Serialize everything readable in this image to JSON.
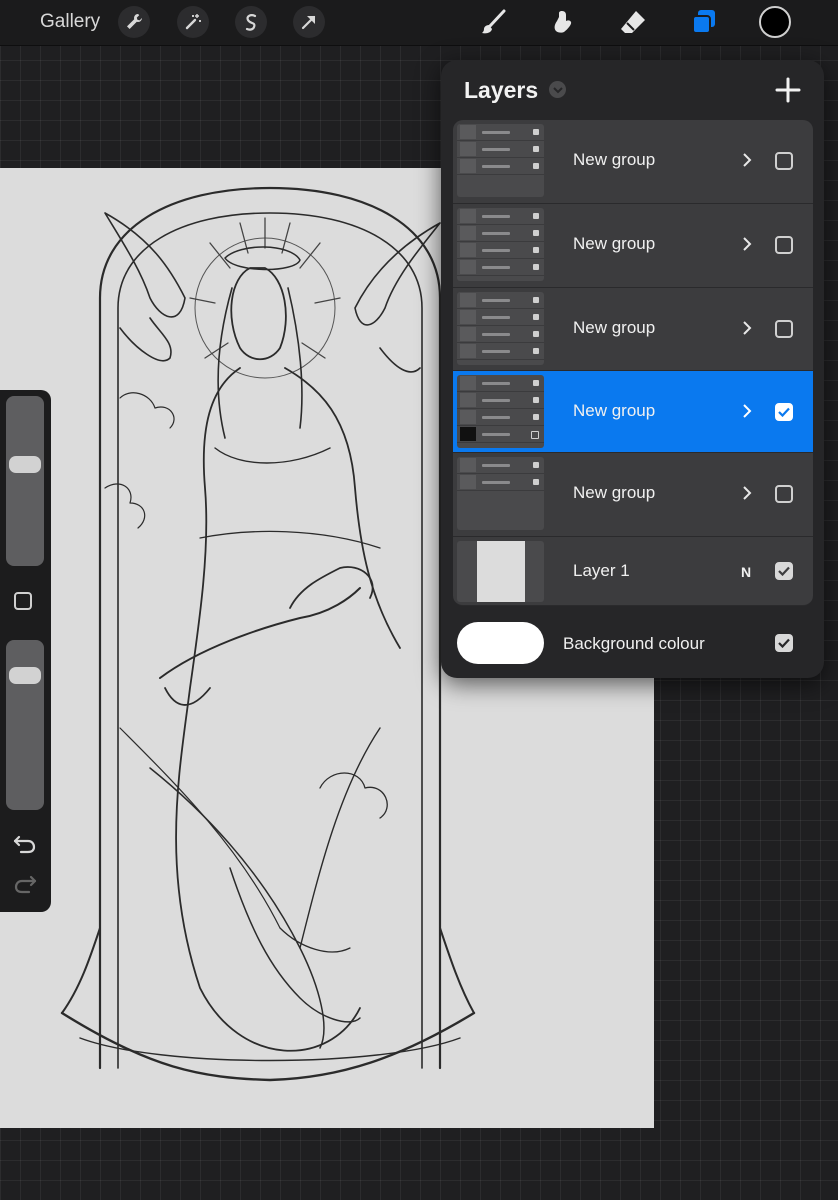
{
  "topbar": {
    "gallery_label": "Gallery",
    "left_tools": [
      "wrench-icon",
      "magic-wand-icon",
      "selection-icon",
      "transform-arrow-icon"
    ],
    "right_tools": [
      "brush-icon",
      "smudge-icon",
      "eraser-icon",
      "layers-icon",
      "color-swatch"
    ],
    "active_tool": "layers-icon",
    "active_color": "#000000",
    "accent_color": "#0a79ef"
  },
  "sidebar": {
    "brush_size_level": 0.13,
    "opacity_level": 0.2,
    "items": [
      "brush-size-slider",
      "modify-button",
      "opacity-slider",
      "undo-icon",
      "redo-icon"
    ]
  },
  "layers_panel": {
    "title": "Layers",
    "add_icon": "plus-icon",
    "layers": [
      {
        "name": "New group",
        "type": "group",
        "visible": false,
        "selected": false,
        "thumb_rows": [
          "Layer 3",
          "New group",
          "Layer 15"
        ]
      },
      {
        "name": "New group",
        "type": "group",
        "visible": false,
        "selected": false,
        "thumb_rows": [
          "Layer 3",
          "Layer 4",
          "Layer 13",
          "Layer 20"
        ]
      },
      {
        "name": "New group",
        "type": "group",
        "visible": false,
        "selected": false,
        "thumb_rows": [
          "Layer 3",
          "Layer 6",
          "Layer 12",
          "Layer 4"
        ]
      },
      {
        "name": "New group",
        "type": "group",
        "visible": true,
        "selected": true,
        "thumb_rows": [
          "Layer 28",
          "Layer 24",
          "Layer 19",
          "Inserted Image"
        ]
      },
      {
        "name": "New group",
        "type": "group",
        "visible": false,
        "selected": false,
        "thumb_rows": [
          "Layer 3",
          "From selection"
        ]
      },
      {
        "name": "Layer 1",
        "type": "layer",
        "blend_mode": "N",
        "visible": true,
        "selected": false
      }
    ],
    "background": {
      "label": "Background colour",
      "color": "#ffffff",
      "visible": true
    }
  }
}
